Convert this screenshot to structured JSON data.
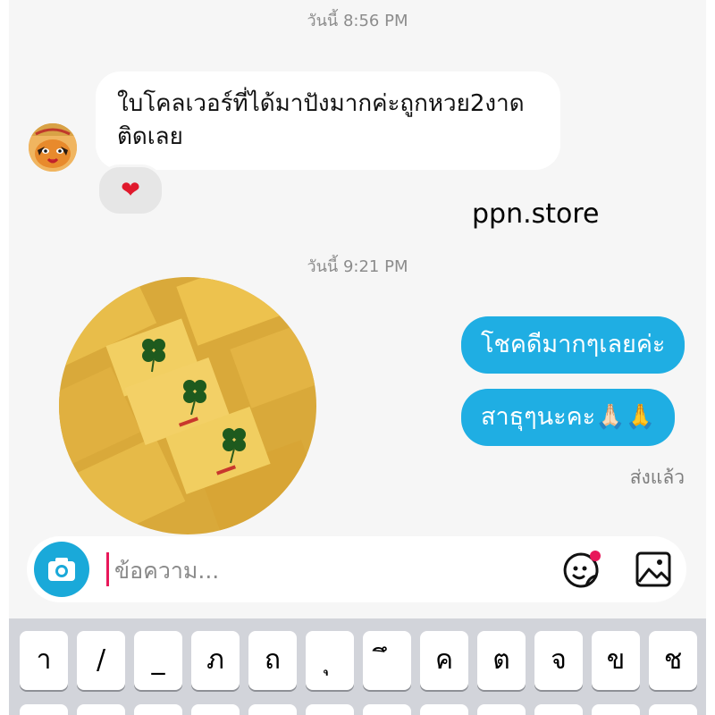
{
  "conversation": {
    "timestamp_1": "วันนี้ 8:56 PM",
    "incoming_message": "ใบโคลเวอร์ที่ได้มาปังมากค่ะถูกหวย2งาดติดเลย",
    "reaction": "❤",
    "store_label": "ppn.store",
    "timestamp_2": "วันนี้ 9:21 PM",
    "outgoing_messages": [
      "โชคดีมากๆเลยค่ะ",
      "สาธุๆนะคะ🙏🏻🙏"
    ],
    "status": "ส่งแล้ว"
  },
  "composer": {
    "placeholder": "ข้อความ...",
    "icons": [
      "camera-icon",
      "sticker-icon",
      "gallery-icon"
    ],
    "accent_color": "#1aa9d9",
    "notification_dot_color": "#e8185a"
  },
  "keyboard": {
    "row1": [
      "า",
      "/",
      "_",
      "ภ",
      "ถ",
      "ุ",
      "ึ",
      "ค",
      "ต",
      "จ",
      "ข",
      "ช"
    ]
  },
  "colors": {
    "outgoing_bubble": "#1faee3",
    "incoming_bubble": "#ffffff",
    "background": "#f6f6f6"
  }
}
